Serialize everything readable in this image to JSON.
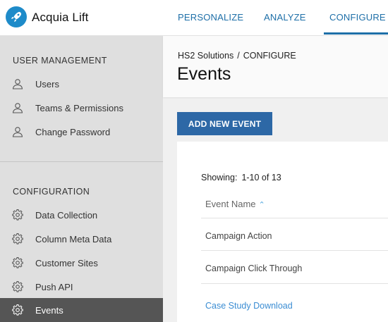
{
  "app": {
    "brand": "Acquia Lift"
  },
  "nav": {
    "tabs": [
      {
        "label": "PERSONALIZE"
      },
      {
        "label": "ANALYZE"
      },
      {
        "label": "CONFIGURE",
        "active": true
      }
    ]
  },
  "sidebar": {
    "user_management": {
      "title": "USER MANAGEMENT",
      "items": [
        {
          "label": "Users",
          "icon": "user-icon"
        },
        {
          "label": "Teams & Permissions",
          "icon": "user-icon"
        },
        {
          "label": "Change Password",
          "icon": "user-icon"
        }
      ]
    },
    "configuration": {
      "title": "CONFIGURATION",
      "items": [
        {
          "label": "Data Collection",
          "icon": "gear-icon"
        },
        {
          "label": "Column Meta Data",
          "icon": "gear-icon"
        },
        {
          "label": "Customer Sites",
          "icon": "gear-icon"
        },
        {
          "label": "Push API",
          "icon": "gear-icon"
        },
        {
          "label": "Events",
          "icon": "gear-icon",
          "active": true
        }
      ]
    }
  },
  "main": {
    "breadcrumb": {
      "parent": "HS2 Solutions",
      "separator": "/",
      "current": "CONFIGURE"
    },
    "title": "Events",
    "add_button": "ADD NEW EVENT",
    "showing_label": "Showing:",
    "showing_value": "1-10 of 13",
    "column_header": "Event Name",
    "rows": [
      {
        "name": "Campaign Action"
      },
      {
        "name": "Campaign Click Through"
      },
      {
        "name": "Case Study Download"
      }
    ]
  },
  "colors": {
    "accent": "#1e6fa8",
    "button": "#2d68a6",
    "logo": "#1e8bc9",
    "sidebar_active": "#555555",
    "link": "#3b8dd3"
  }
}
